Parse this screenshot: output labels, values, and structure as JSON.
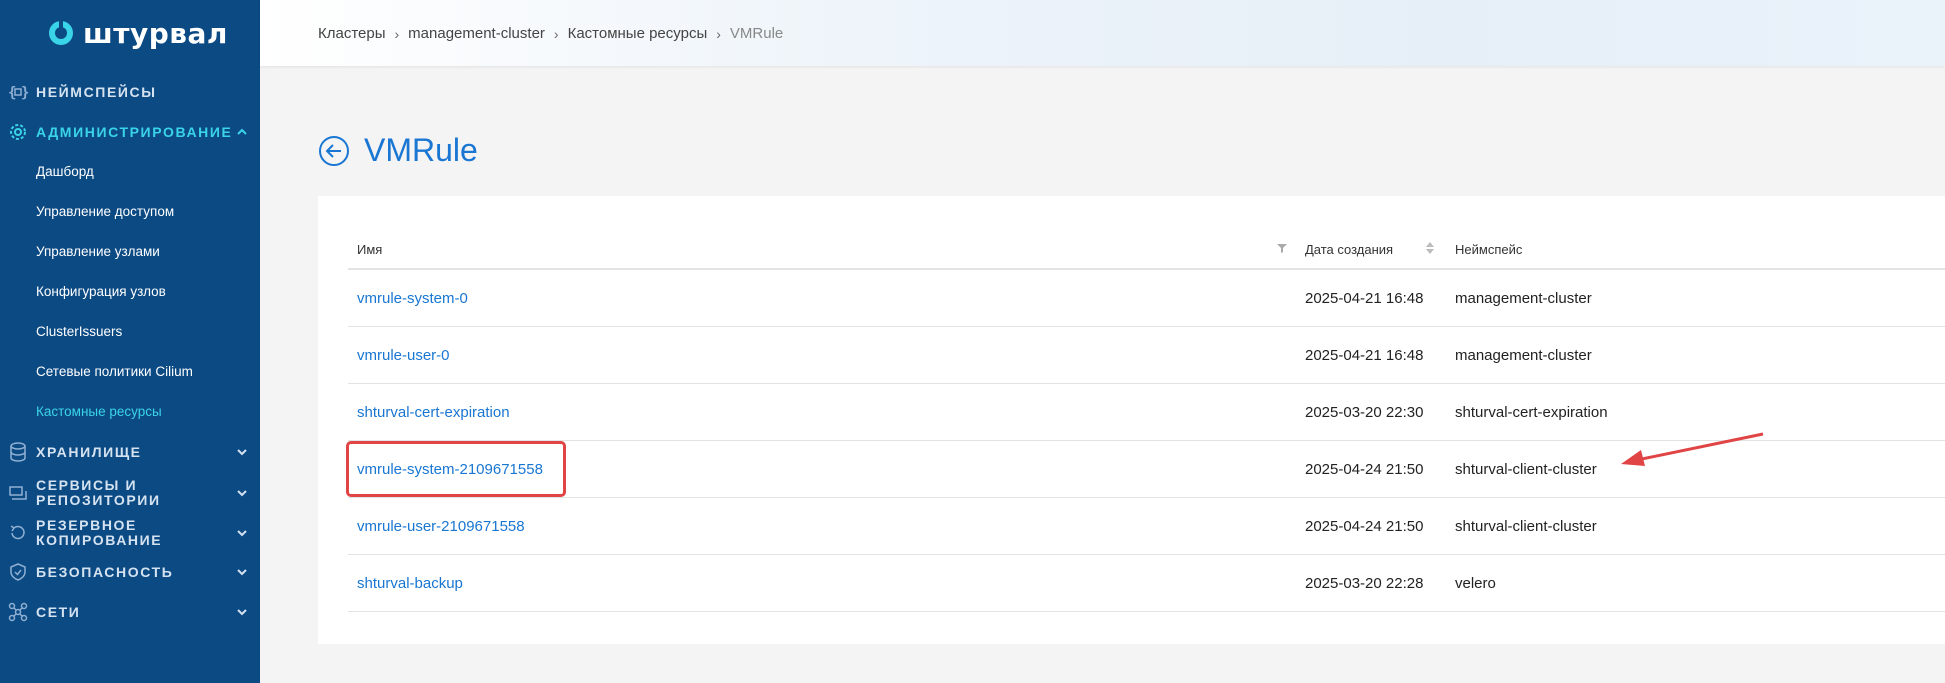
{
  "sidebar": {
    "brand": "штурвал",
    "nav": [
      {
        "label": "НЕЙМСПЕЙСЫ",
        "icon": "namespace-icon"
      },
      {
        "label": "АДМИНИСТРИРОВАНИЕ",
        "icon": "gear-icon"
      },
      {
        "label": "ХРАНИЛИЩЕ",
        "icon": "database-icon"
      },
      {
        "label": "СЕРВИСЫ И",
        "label2": "РЕПОЗИТОРИИ",
        "icon": "services-icon"
      },
      {
        "label": "РЕЗЕРВНОЕ",
        "label2": "КОПИРОВАНИЕ",
        "icon": "backup-icon"
      },
      {
        "label": "БЕЗОПАСНОСТЬ",
        "icon": "shield-icon"
      },
      {
        "label": "СЕТИ",
        "icon": "network-icon"
      }
    ],
    "admin_sub": [
      "Дашборд",
      "Управление доступом",
      "Управление узлами",
      "Конфигурация узлов",
      "ClusterIssuers",
      "Сетевые политики Cilium",
      "Кастомные ресурсы"
    ]
  },
  "breadcrumb": [
    "Кластеры",
    "management-cluster",
    "Кастомные ресурсы",
    "VMRule"
  ],
  "page": {
    "title": "VMRule"
  },
  "table": {
    "headers": [
      "Имя",
      "Дата создания",
      "Неймспейс"
    ],
    "rows": [
      {
        "name": "vmrule-system-0",
        "created": "2025-04-21 16:48",
        "namespace": "management-cluster"
      },
      {
        "name": "vmrule-user-0",
        "created": "2025-04-21 16:48",
        "namespace": "management-cluster"
      },
      {
        "name": "shturval-cert-expiration",
        "created": "2025-03-20 22:30",
        "namespace": "shturval-cert-expiration"
      },
      {
        "name": "vmrule-system-2109671558",
        "created": "2025-04-24 21:50",
        "namespace": "shturval-client-cluster"
      },
      {
        "name": "vmrule-user-2109671558",
        "created": "2025-04-24 21:50",
        "namespace": "shturval-client-cluster"
      },
      {
        "name": "shturval-backup",
        "created": "2025-03-20 22:28",
        "namespace": "velero"
      }
    ]
  },
  "colors": {
    "sidebar": "#0c4a84",
    "accent": "#3ad4e8",
    "link": "#1976d2",
    "highlight": "#e04444"
  }
}
